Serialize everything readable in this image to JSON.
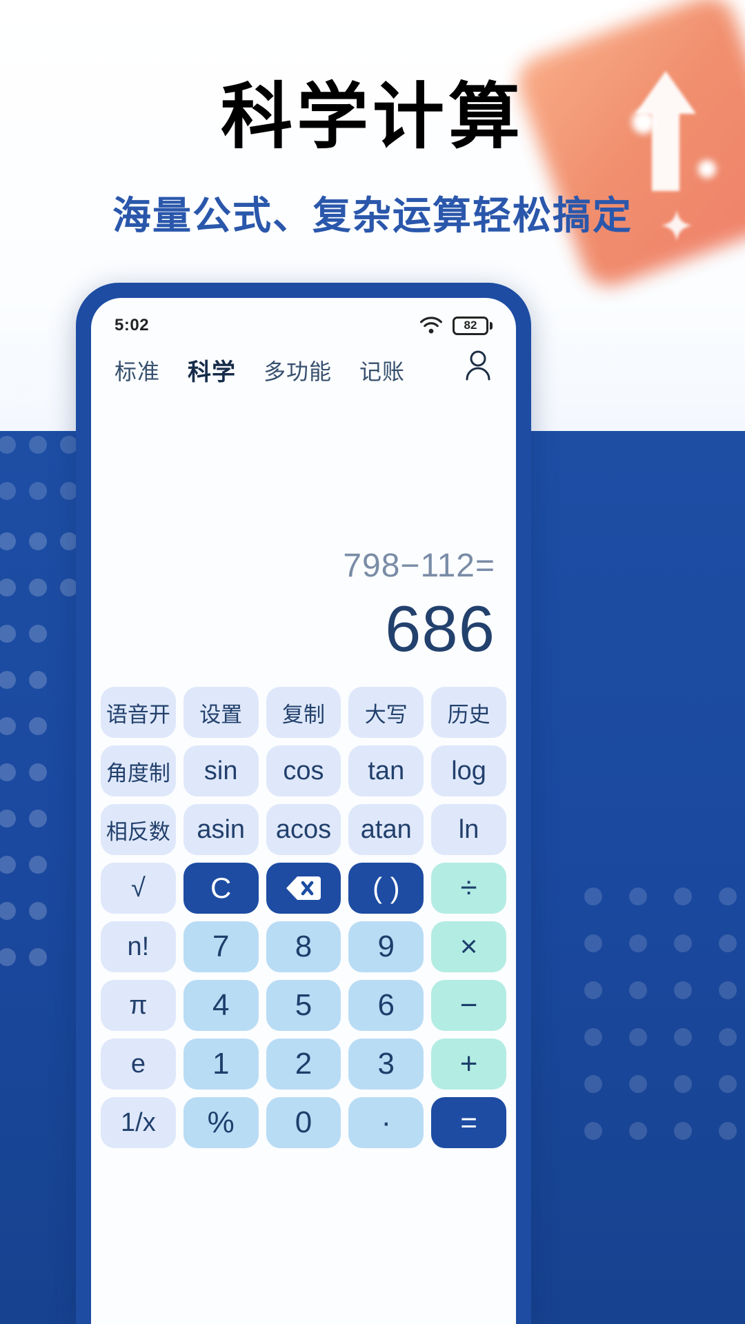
{
  "hero": {
    "title": "科学计算",
    "subtitle": "海量公式、复杂运算轻松搞定",
    "title_color": "#000000",
    "subtitle_color": "#2a57ab"
  },
  "theme": {
    "brand_blue": "#1d4ca2",
    "key_fn_bg": "#dfe8fa",
    "key_num_bg": "#b9dcf5",
    "key_op_bg": "#b3ece3",
    "key_dark_bg": "#1d4ca2",
    "text_dark": "#1d3f6b"
  },
  "statusbar": {
    "time": "5:02",
    "wifi_icon": "wifi-icon",
    "battery_level": "82"
  },
  "tabs": [
    {
      "label": "标准",
      "active": false
    },
    {
      "label": "科学",
      "active": true
    },
    {
      "label": "多功能",
      "active": false
    },
    {
      "label": "记账",
      "active": false
    }
  ],
  "account_icon": "user-icon",
  "display": {
    "expression": "798−112=",
    "result": "686"
  },
  "keypad": {
    "rows": [
      [
        {
          "label": "语音开",
          "style": "fn"
        },
        {
          "label": "设置",
          "style": "fn"
        },
        {
          "label": "复制",
          "style": "fn"
        },
        {
          "label": "大写",
          "style": "fn"
        },
        {
          "label": "历史",
          "style": "fn"
        }
      ],
      [
        {
          "label": "角度制",
          "style": "fn"
        },
        {
          "label": "sin",
          "style": "fn-en"
        },
        {
          "label": "cos",
          "style": "fn-en"
        },
        {
          "label": "tan",
          "style": "fn-en"
        },
        {
          "label": "log",
          "style": "fn-en"
        }
      ],
      [
        {
          "label": "相反数",
          "style": "fn"
        },
        {
          "label": "asin",
          "style": "fn-en"
        },
        {
          "label": "acos",
          "style": "fn-en"
        },
        {
          "label": "atan",
          "style": "fn-en"
        },
        {
          "label": "ln",
          "style": "fn-en"
        }
      ],
      [
        {
          "label": "√",
          "style": "fn-en"
        },
        {
          "label": "C",
          "style": "dark"
        },
        {
          "label": "⌫",
          "style": "dark",
          "icon": "backspace-icon"
        },
        {
          "label": "( )",
          "style": "dark"
        },
        {
          "label": "÷",
          "style": "op"
        }
      ],
      [
        {
          "label": "n!",
          "style": "fn-en"
        },
        {
          "label": "7",
          "style": "num"
        },
        {
          "label": "8",
          "style": "num"
        },
        {
          "label": "9",
          "style": "num"
        },
        {
          "label": "×",
          "style": "op"
        }
      ],
      [
        {
          "label": "π",
          "style": "fn-en"
        },
        {
          "label": "4",
          "style": "num"
        },
        {
          "label": "5",
          "style": "num"
        },
        {
          "label": "6",
          "style": "num"
        },
        {
          "label": "−",
          "style": "op"
        }
      ],
      [
        {
          "label": "e",
          "style": "fn-en"
        },
        {
          "label": "1",
          "style": "num"
        },
        {
          "label": "2",
          "style": "num"
        },
        {
          "label": "3",
          "style": "num"
        },
        {
          "label": "+",
          "style": "op"
        }
      ],
      [
        {
          "label": "1/x",
          "style": "fn-en"
        },
        {
          "label": "%",
          "style": "num"
        },
        {
          "label": "0",
          "style": "num"
        },
        {
          "label": "·",
          "style": "num"
        },
        {
          "label": "=",
          "style": "dark"
        }
      ]
    ]
  }
}
